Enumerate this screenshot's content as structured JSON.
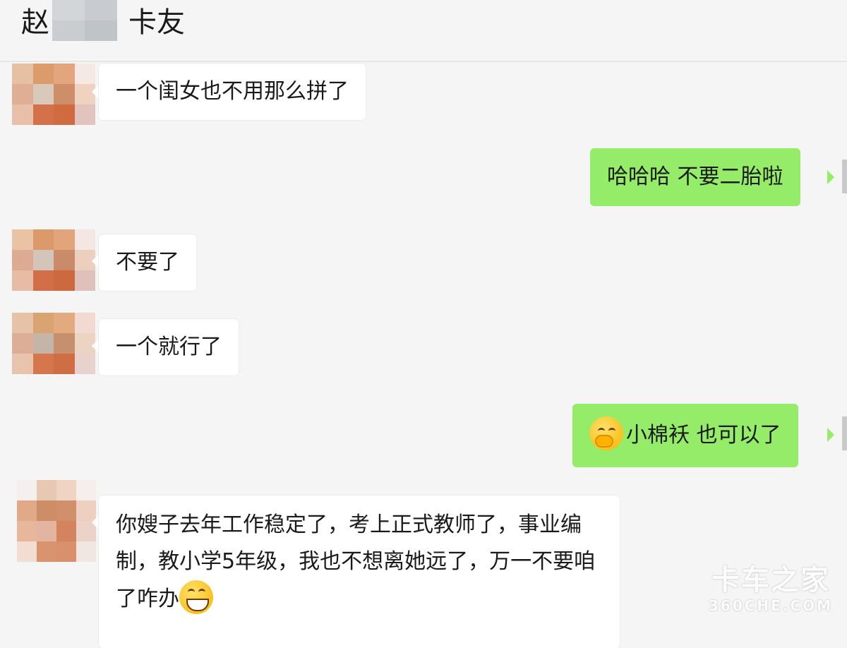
{
  "header": {
    "title_surname": "赵",
    "title_suffix": "卡友"
  },
  "messages": [
    {
      "side": "in",
      "text": "一个闺女也不用那么拼了"
    },
    {
      "side": "out",
      "text": "哈哈哈 不要二胎啦"
    },
    {
      "side": "in",
      "text": "不要了"
    },
    {
      "side": "in",
      "text": "一个就行了"
    },
    {
      "side": "out",
      "emoji": "thinking-hand-over-mouth-emoji",
      "text": "小棉袄 也可以了"
    },
    {
      "side": "in",
      "text": "你嫂子去年工作稳定了，考上正式教师了，事业编制，教小学5年级，我也不想离她远了，万一不要咱了咋办",
      "emoji": "grinning-emoji"
    }
  ],
  "watermark": {
    "main": "卡车之家",
    "sub": "360CHE.COM"
  },
  "colors": {
    "background": "#f5f5f5",
    "incoming_bubble": "#ffffff",
    "outgoing_bubble": "#95ec69"
  }
}
